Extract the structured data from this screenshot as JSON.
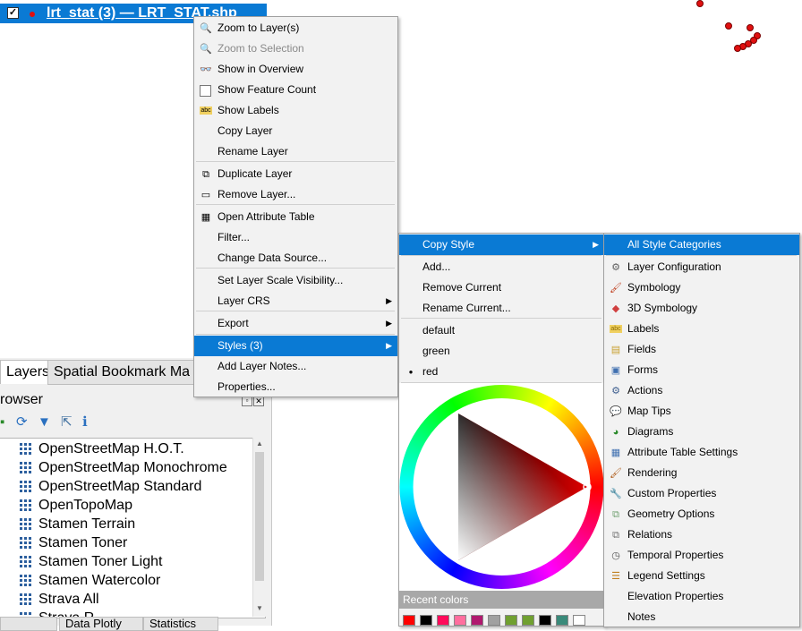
{
  "layer_row": {
    "checkbox": "✓",
    "name": "lrt_stat (3) — LRT_STAT.shp"
  },
  "panel": {
    "tabs": [
      "Layers",
      "Spatial Bookmark Ma"
    ],
    "title": "rowser",
    "browser_items": [
      "OpenStreetMap H.O.T.",
      "OpenStreetMap Monochrome",
      "OpenStreetMap Standard",
      "OpenTopoMap",
      "Stamen Terrain",
      "Stamen Toner",
      "Stamen Toner Light",
      "Stamen Watercolor",
      "Strava All",
      "Strava R"
    ],
    "bottom_tabs": [
      "",
      "Data Plotly",
      "Statistics"
    ]
  },
  "context_menu": {
    "items": [
      {
        "label": "Zoom to Layer(s)",
        "icon": "zoom-icon",
        "glyph": "🔍",
        "disabled": false
      },
      {
        "label": "Zoom to Selection",
        "icon": "zoom-selection-icon",
        "glyph": "🔍",
        "disabled": true
      },
      {
        "label": "Show in Overview",
        "icon": "overview-icon",
        "glyph": "👓",
        "disabled": false
      },
      {
        "label": "Show Feature Count",
        "icon": "checkbox-icon",
        "glyph": "",
        "disabled": false
      },
      {
        "label": "Show Labels",
        "icon": "labels-icon",
        "glyph": "abc",
        "disabled": false
      },
      {
        "label": "Copy Layer",
        "icon": "",
        "glyph": "",
        "disabled": false
      },
      {
        "label": "Rename Layer",
        "icon": "",
        "glyph": "",
        "disabled": false
      },
      {
        "label": "Duplicate Layer",
        "icon": "duplicate-icon",
        "glyph": "⧉",
        "disabled": false
      },
      {
        "label": "Remove Layer...",
        "icon": "remove-icon",
        "glyph": "▭",
        "disabled": false
      },
      {
        "label": "Open Attribute Table",
        "icon": "table-icon",
        "glyph": "▦",
        "disabled": false
      },
      {
        "label": "Filter...",
        "icon": "",
        "glyph": "",
        "disabled": false
      },
      {
        "label": "Change Data Source...",
        "icon": "",
        "glyph": "",
        "disabled": false
      },
      {
        "label": "Set Layer Scale Visibility...",
        "icon": "",
        "glyph": "",
        "disabled": false
      },
      {
        "label": "Layer CRS",
        "icon": "",
        "glyph": "",
        "disabled": false,
        "submenu": true
      },
      {
        "label": "Export",
        "icon": "",
        "glyph": "",
        "disabled": false,
        "submenu": true
      },
      {
        "label": "Styles (3)",
        "icon": "",
        "glyph": "",
        "disabled": false,
        "submenu": true,
        "selected": true
      },
      {
        "label": "Add Layer Notes...",
        "icon": "",
        "glyph": "",
        "disabled": false
      },
      {
        "label": "Properties...",
        "icon": "",
        "glyph": "",
        "disabled": false
      }
    ]
  },
  "styles_menu": {
    "items": [
      {
        "label": "Copy Style",
        "submenu": true,
        "selected": true
      },
      {
        "label": "Add..."
      },
      {
        "label": "Remove Current"
      },
      {
        "label": "Rename Current..."
      },
      {
        "label": "default"
      },
      {
        "label": "green"
      },
      {
        "label": "red",
        "bullet": "●"
      }
    ],
    "recent_colors_label": "Recent colors",
    "recent_colors": [
      "#ff0000",
      "#000000",
      "#ff0a5a",
      "#ff6e9e",
      "#b0186e",
      "#a0a0a0",
      "#70a030",
      "#70a030",
      "#000000",
      "#3a8a7a",
      "#ffffff"
    ]
  },
  "copy_style_menu": {
    "items": [
      {
        "label": "All Style Categories",
        "icon": "",
        "selected": true
      },
      {
        "label": "Layer Configuration",
        "icon": "layer-config-icon",
        "glyph": "⚙",
        "color": "#606060"
      },
      {
        "label": "Symbology",
        "icon": "symbology-icon",
        "glyph": "🖌",
        "color": "#c04020"
      },
      {
        "label": "3D Symbology",
        "icon": "3d-symbology-icon",
        "glyph": "◆",
        "color": "#d04040"
      },
      {
        "label": "Labels",
        "icon": "labels-icon",
        "glyph": "abc",
        "color": "#8a6a00"
      },
      {
        "label": "Fields",
        "icon": "fields-icon",
        "glyph": "▤",
        "color": "#c8a030"
      },
      {
        "label": "Forms",
        "icon": "forms-icon",
        "glyph": "▣",
        "color": "#4070b0"
      },
      {
        "label": "Actions",
        "icon": "actions-icon",
        "glyph": "⚙",
        "color": "#406090"
      },
      {
        "label": "Map Tips",
        "icon": "map-tips-icon",
        "glyph": "💬",
        "color": "#c0a000"
      },
      {
        "label": "Diagrams",
        "icon": "diagrams-icon",
        "glyph": "◕",
        "color": "#2a8a2a"
      },
      {
        "label": "Attribute Table Settings",
        "icon": "attribute-table-icon",
        "glyph": "▦",
        "color": "#4070b0"
      },
      {
        "label": "Rendering",
        "icon": "rendering-icon",
        "glyph": "🖌",
        "color": "#b06020"
      },
      {
        "label": "Custom Properties",
        "icon": "custom-properties-icon",
        "glyph": "🔧",
        "color": "#606060"
      },
      {
        "label": "Geometry Options",
        "icon": "geometry-options-icon",
        "glyph": "⧉",
        "color": "#70a070"
      },
      {
        "label": "Relations",
        "icon": "relations-icon",
        "glyph": "⧉",
        "color": "#707070"
      },
      {
        "label": "Temporal Properties",
        "icon": "temporal-icon",
        "glyph": "◷",
        "color": "#505050"
      },
      {
        "label": "Legend Settings",
        "icon": "legend-icon",
        "glyph": "☰",
        "color": "#c08020"
      },
      {
        "label": "Elevation Properties",
        "icon": "",
        "glyph": ""
      },
      {
        "label": "Notes",
        "icon": "",
        "glyph": ""
      }
    ]
  },
  "colors": {
    "accent": "#0a7ad4",
    "point": "#e01010"
  }
}
